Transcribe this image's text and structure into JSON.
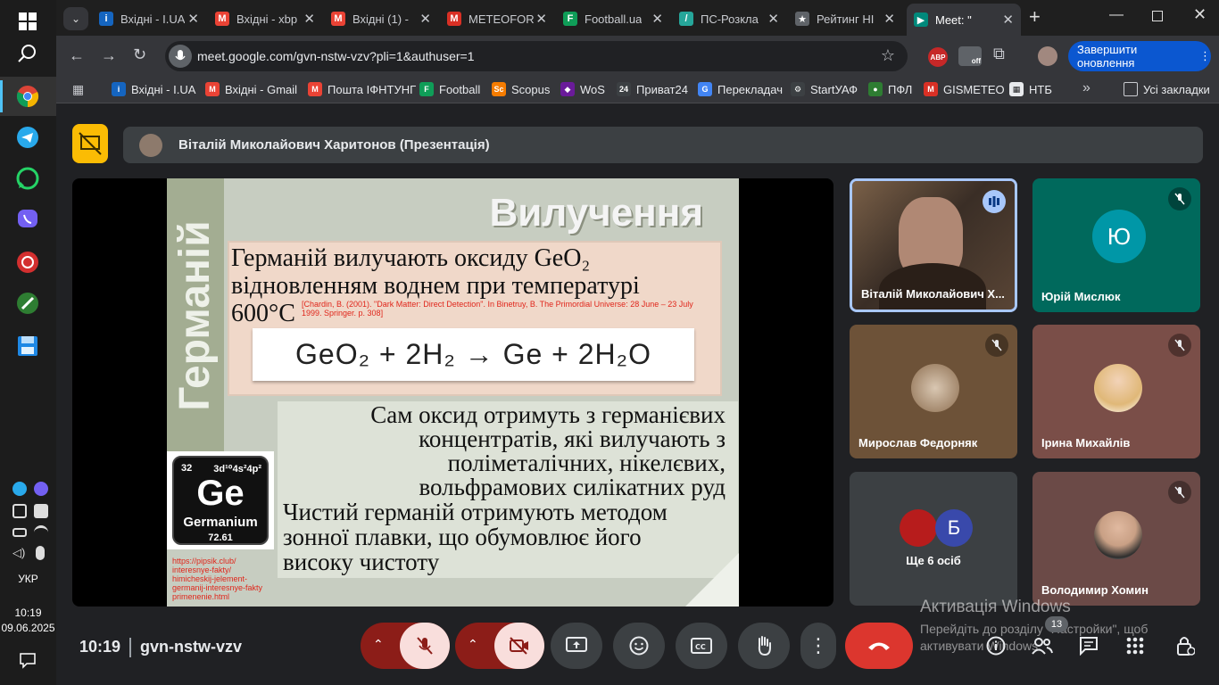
{
  "taskbar": {
    "lang": "УКР",
    "time": "10:19",
    "date": "09.06.2025"
  },
  "tabs": [
    {
      "label": "Вхідні - I.UA",
      "color": "#1565c0",
      "glyph": "i"
    },
    {
      "label": "Вхідні - xbp",
      "color": "#ea4335",
      "glyph": "M"
    },
    {
      "label": "Вхідні (1) -",
      "color": "#ea4335",
      "glyph": "M"
    },
    {
      "label": "METEOFOR",
      "color": "#d93025",
      "glyph": "M"
    },
    {
      "label": "Football.ua",
      "color": "#0f9d58",
      "glyph": "F"
    },
    {
      "label": "ПС-Розкла",
      "color": "#26a69a",
      "glyph": "/"
    },
    {
      "label": "Рейтинг НІ",
      "color": "#5f6368",
      "glyph": "★"
    },
    {
      "label": "Meet: \"",
      "color": "#00897b",
      "glyph": "▶"
    }
  ],
  "toolbar": {
    "url": "meet.google.com/gvn-nstw-vzv?pli=1&authuser=1",
    "update_label": "Завершити оновлення"
  },
  "bookmarks": [
    {
      "label": "Вхідні - I.UA",
      "color": "#1565c0",
      "glyph": "i"
    },
    {
      "label": "Вхідні - Gmail",
      "color": "#ea4335",
      "glyph": "M"
    },
    {
      "label": "Пошта ІФНТУНГ",
      "color": "#ea4335",
      "glyph": "M"
    },
    {
      "label": "Football",
      "color": "#0f9d58",
      "glyph": "F"
    },
    {
      "label": "Scopus",
      "color": "#f57c00",
      "glyph": "Sc"
    },
    {
      "label": "WoS",
      "color": "#6a1b9a",
      "glyph": "◆"
    },
    {
      "label": "Приват24",
      "color": "#3c4043",
      "glyph": "24"
    },
    {
      "label": "Перекладач",
      "color": "#4285f4",
      "glyph": "G"
    },
    {
      "label": "StartУАФ",
      "color": "#3c4043",
      "glyph": "⚙"
    },
    {
      "label": "ПФЛ",
      "color": "#2e7d32",
      "glyph": "●"
    },
    {
      "label": "GISMETEO",
      "color": "#d93025",
      "glyph": "M"
    },
    {
      "label": "НТБ",
      "color": "#e8eaed",
      "glyph": "▦"
    }
  ],
  "bookmarks_all": "Усі закладки",
  "meet": {
    "presenter": "Віталій Миколайович Харитонов (Презентація)",
    "clock": "10:19",
    "code": "gvn-nstw-vzv",
    "participants_count": "13"
  },
  "slide": {
    "side_title": "Германій",
    "title": "Вилучення",
    "p1": "Германій вилучають оксиду GeO₂ відновленням воднем при температурі 600°C",
    "citation": "[Chardin, B. (2001). \"Dark Matter: Direct Detection\". In Binetruy, B. The Primordial Universe: 28 June – 23 July 1999. Springer. p. 308]",
    "equation": "GeO₂ + 2H₂ → Ge + 2H₂O",
    "p2": "Сам оксид отримуть з германієвих концентратів, які вилучають з поліметалічних, нікелєвих, вольфрамових силікатних руд",
    "p3": "Чистий германій отримують методом зонної плавки, що обумовлює його високу чистоту",
    "element": {
      "number": "32",
      "config": "3d¹⁰4s²4p²",
      "symbol": "Ge",
      "name": "Germanium",
      "mass": "72.61"
    },
    "link": "https://pipsik.club/ interesnye-fakty/ himicheskij-jelement- germanij-interesnye-fakty primenenie.html"
  },
  "tiles": [
    {
      "name": "Віталій Миколайович Х...",
      "type": "video",
      "speaking": true
    },
    {
      "name": "Юрій Мислюк",
      "type": "letter",
      "letter": "Ю",
      "bg": "#00796b",
      "avatar_bg": "#0097a7",
      "muted": true
    },
    {
      "name": "Мирослав Федорняк",
      "type": "photo",
      "bg": "#6d5238",
      "muted": true
    },
    {
      "name": "Ірина Михайлів",
      "type": "photo",
      "bg": "#7a4e48",
      "muted": true
    },
    {
      "name": "Ще 6 осіб",
      "type": "more",
      "letter": "Б",
      "bg": "#3c4043"
    },
    {
      "name": "Володимир Хомин",
      "type": "photo",
      "bg": "#6b4a47",
      "muted": true
    }
  ],
  "activation": {
    "title": "Активація Windows",
    "text": "Перейдіть до розділу \"Настройки\", щоб активувати Windows."
  }
}
